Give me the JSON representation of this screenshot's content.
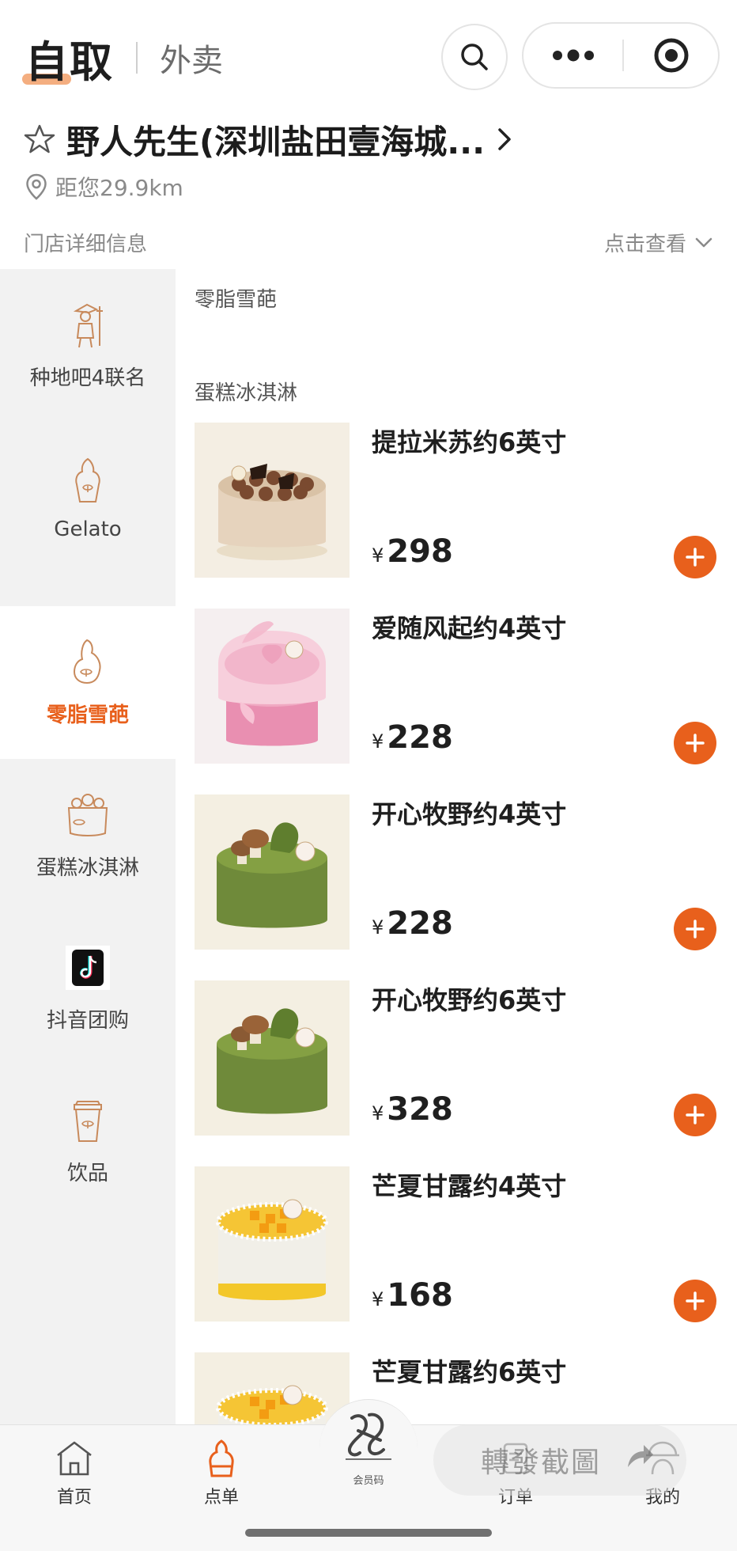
{
  "header": {
    "mode_active": "自取",
    "mode_inactive": "外卖"
  },
  "store": {
    "name": "野人先生(深圳盐田壹海城...",
    "distance": "距您29.9km",
    "detail_label": "门店详细信息",
    "detail_link": "点击查看"
  },
  "sidebar": {
    "items": [
      {
        "label": "种地吧4联名",
        "icon": "farmer-icon"
      },
      {
        "label": "Gelato",
        "icon": "gelato-cone-icon"
      },
      {
        "label": "零脂雪葩",
        "icon": "sorbet-icon",
        "active": true
      },
      {
        "label": "蛋糕冰淇淋",
        "icon": "cake-icon"
      },
      {
        "label": "抖音团购",
        "icon": "douyin-icon"
      },
      {
        "label": "饮品",
        "icon": "cup-icon"
      }
    ]
  },
  "main": {
    "sections": [
      {
        "title": "零脂雪葩"
      },
      {
        "title": "蛋糕冰淇淋"
      }
    ],
    "currency": "¥",
    "products": [
      {
        "name": "提拉米苏约6英寸",
        "price": "298",
        "style": "tiramisu"
      },
      {
        "name": "爱随风起约4英寸",
        "price": "228",
        "style": "pink"
      },
      {
        "name": "开心牧野约4英寸",
        "price": "228",
        "style": "matcha"
      },
      {
        "name": "开心牧野约6英寸",
        "price": "328",
        "style": "matcha"
      },
      {
        "name": "芒夏甘露约4英寸",
        "price": "168",
        "style": "mango"
      },
      {
        "name": "芒夏甘露约6英寸",
        "price": "",
        "style": "mango"
      }
    ]
  },
  "tabbar": {
    "items": [
      {
        "label": "首页",
        "icon": "home-icon"
      },
      {
        "label": "点单",
        "icon": "order-cone-icon",
        "active": true
      },
      {
        "label": "会员码",
        "icon": "member-logo-icon"
      },
      {
        "label": "订单",
        "icon": "orders-icon"
      },
      {
        "label": "我的",
        "icon": "profile-icon"
      }
    ],
    "watermark": "轉發截圖"
  },
  "colors": {
    "accent": "#e8601c",
    "sidebar_bg": "#f2f2f2",
    "text": "#222222"
  }
}
